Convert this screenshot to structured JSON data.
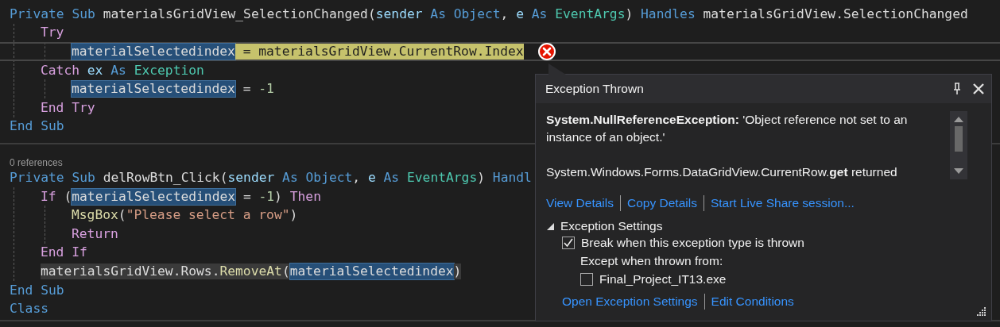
{
  "editor": {
    "methods": [
      {
        "lines": [
          {
            "segments": [
              {
                "kind": "none",
                "tokens": [
                  {
                    "text": "Private",
                    "kind": "keyword"
                  },
                  {
                    "text": " Sub ",
                    "kind": "keyword"
                  },
                  {
                    "text": "materialsGridView_SelectionChanged(",
                    "kind": "plain"
                  },
                  {
                    "text": "sender",
                    "kind": "param"
                  },
                  {
                    "text": " As Object",
                    "kind": "keyword"
                  },
                  {
                    "text": ", ",
                    "kind": "plain"
                  },
                  {
                    "text": "e",
                    "kind": "param"
                  },
                  {
                    "text": " As ",
                    "kind": "keyword"
                  },
                  {
                    "text": "EventArgs",
                    "kind": "type"
                  },
                  {
                    "text": ") ",
                    "kind": "plain"
                  },
                  {
                    "text": "Handles",
                    "kind": "keyword"
                  },
                  {
                    "text": " materialsGridView.SelectionChanged",
                    "kind": "plain"
                  }
                ]
              }
            ],
            "current": false,
            "children": [
              {
                "segments": [
                  {
                    "kind": "none",
                    "tokens": [
                      {
                        "text": "Try",
                        "kind": "control"
                      }
                    ]
                  }
                ],
                "current": false,
                "children": [
                  {
                    "segments": [
                      {
                        "kind": "reference",
                        "tokens": [
                          {
                            "text": "materialSelectedindex",
                            "kind": "plain"
                          }
                        ]
                      },
                      {
                        "kind": "statement",
                        "tokens": [
                          {
                            "text": " = materialsGridView.CurrentRow.Index",
                            "kind": "plain"
                          }
                        ]
                      }
                    ],
                    "current": true,
                    "error": true
                  }
                ]
              },
              {
                "segments": [
                  {
                    "kind": "none",
                    "tokens": [
                      {
                        "text": "Catch",
                        "kind": "control"
                      },
                      {
                        "text": " ex",
                        "kind": "param"
                      },
                      {
                        "text": " As ",
                        "kind": "keyword"
                      },
                      {
                        "text": "Exception",
                        "kind": "type"
                      }
                    ]
                  }
                ],
                "current": false,
                "children": [
                  {
                    "segments": [
                      {
                        "kind": "reference",
                        "tokens": [
                          {
                            "text": "materialSelectedindex",
                            "kind": "plain"
                          }
                        ]
                      },
                      {
                        "kind": "none",
                        "tokens": [
                          {
                            "text": " = ",
                            "kind": "plain"
                          },
                          {
                            "text": "-1",
                            "kind": "number"
                          }
                        ]
                      }
                    ],
                    "current": false
                  }
                ]
              },
              {
                "segments": [
                  {
                    "kind": "none",
                    "tokens": [
                      {
                        "text": "End Try",
                        "kind": "control"
                      }
                    ]
                  }
                ],
                "current": false
              }
            ]
          },
          {
            "segments": [
              {
                "kind": "none",
                "tokens": [
                  {
                    "text": "End Sub",
                    "kind": "keyword"
                  }
                ]
              }
            ],
            "current": false
          }
        ]
      },
      {
        "codelens": "0 references",
        "lines": [
          {
            "segments": [
              {
                "kind": "none",
                "tokens": [
                  {
                    "text": "Private",
                    "kind": "keyword"
                  },
                  {
                    "text": " Sub ",
                    "kind": "keyword"
                  },
                  {
                    "text": "delRowBtn_Click(",
                    "kind": "plain"
                  },
                  {
                    "text": "sender",
                    "kind": "param"
                  },
                  {
                    "text": " As Object",
                    "kind": "keyword"
                  },
                  {
                    "text": ", ",
                    "kind": "plain"
                  },
                  {
                    "text": "e",
                    "kind": "param"
                  },
                  {
                    "text": " As ",
                    "kind": "keyword"
                  },
                  {
                    "text": "EventArgs",
                    "kind": "type"
                  },
                  {
                    "text": ") ",
                    "kind": "plain"
                  },
                  {
                    "text": "Handl",
                    "kind": "keyword"
                  }
                ]
              }
            ],
            "current": false,
            "children": [
              {
                "segments": [
                  {
                    "kind": "none",
                    "tokens": [
                      {
                        "text": "If",
                        "kind": "control"
                      },
                      {
                        "text": " (",
                        "kind": "plain"
                      }
                    ]
                  },
                  {
                    "kind": "reference",
                    "tokens": [
                      {
                        "text": "materialSelectedindex",
                        "kind": "plain"
                      }
                    ]
                  },
                  {
                    "kind": "none",
                    "tokens": [
                      {
                        "text": " = ",
                        "kind": "plain"
                      },
                      {
                        "text": "-1",
                        "kind": "number"
                      },
                      {
                        "text": ") ",
                        "kind": "plain"
                      },
                      {
                        "text": "Then",
                        "kind": "control"
                      }
                    ]
                  }
                ],
                "current": false,
                "children": [
                  {
                    "segments": [
                      {
                        "kind": "none",
                        "tokens": [
                          {
                            "text": "MsgBox",
                            "kind": "method"
                          },
                          {
                            "text": "(",
                            "kind": "plain"
                          },
                          {
                            "text": "\"Please select a row\"",
                            "kind": "string"
                          },
                          {
                            "text": ")",
                            "kind": "plain"
                          }
                        ]
                      }
                    ],
                    "current": false
                  },
                  {
                    "segments": [
                      {
                        "kind": "none",
                        "tokens": [
                          {
                            "text": "Return",
                            "kind": "control"
                          }
                        ]
                      }
                    ],
                    "current": false
                  }
                ]
              },
              {
                "segments": [
                  {
                    "kind": "none",
                    "tokens": [
                      {
                        "text": "End If",
                        "kind": "control"
                      }
                    ]
                  }
                ],
                "current": false
              },
              {
                "segments": [
                  {
                    "kind": "selection",
                    "tokens": [
                      {
                        "text": "materialsGridView.Rows.",
                        "kind": "plain"
                      },
                      {
                        "text": "RemoveAt",
                        "kind": "method"
                      },
                      {
                        "text": "(",
                        "kind": "plain"
                      }
                    ]
                  },
                  {
                    "kind": "reference",
                    "tokens": [
                      {
                        "text": "materialSelectedindex",
                        "kind": "plain"
                      }
                    ]
                  },
                  {
                    "kind": "selection",
                    "tokens": [
                      {
                        "text": ")",
                        "kind": "plain"
                      }
                    ]
                  }
                ],
                "current": false
              }
            ]
          },
          {
            "segments": [
              {
                "kind": "none",
                "tokens": [
                  {
                    "text": "End Sub",
                    "kind": "keyword"
                  }
                ]
              }
            ],
            "current": false
          },
          {
            "segments": [
              {
                "kind": "none",
                "tokens": [
                  {
                    "text": "Class",
                    "kind": "keyword"
                  }
                ]
              }
            ],
            "current": false
          }
        ]
      }
    ]
  },
  "popup": {
    "title": "Exception Thrown",
    "message": "**System.NullReferenceException:** 'Object reference not set to an instance of an object.'",
    "detail": "System.Windows.Forms.DataGridView.CurrentRow.**get** returned",
    "links": [
      "View Details",
      "Copy Details",
      "Start Live Share session..."
    ],
    "settings": {
      "label": "Exception Settings",
      "expanded": true,
      "break_option": {
        "label": "Break when this exception type is thrown",
        "checked": true
      },
      "except_label": "Except when thrown from:",
      "module_option": {
        "label": "Final_Project_IT13.exe",
        "checked": false
      }
    },
    "footer_links": [
      "Open Exception Settings",
      "Edit Conditions"
    ]
  }
}
